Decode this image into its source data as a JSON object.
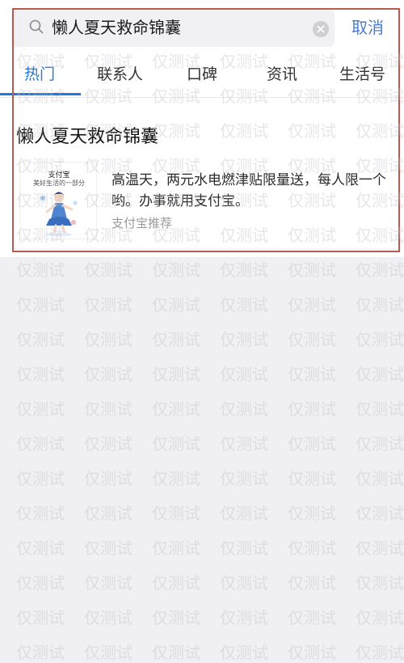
{
  "search": {
    "query": "懒人夏天救命锦囊",
    "cancel_label": "取消"
  },
  "tabs": [
    {
      "label": "热门",
      "active": true
    },
    {
      "label": "联系人",
      "active": false
    },
    {
      "label": "口碑",
      "active": false
    },
    {
      "label": "资讯",
      "active": false
    },
    {
      "label": "生活号",
      "active": false
    }
  ],
  "result": {
    "title": "懒人夏天救命锦囊",
    "thumbnail": {
      "brand": "支付宝",
      "slogan": "美好生活的一部分"
    },
    "description": "高温天，两元水电燃津贴限量送，每人限一个哟。办事就用支付宝。",
    "source": "支付宝推荐"
  },
  "watermark": {
    "text": "仅测试"
  },
  "colors": {
    "accent": "#1e7ae0",
    "cancel": "#4a7bc9",
    "highlight_border": "#b85a52",
    "background": "#f0eff4"
  },
  "icons": {
    "search": "search-icon",
    "clear": "clear-icon"
  }
}
